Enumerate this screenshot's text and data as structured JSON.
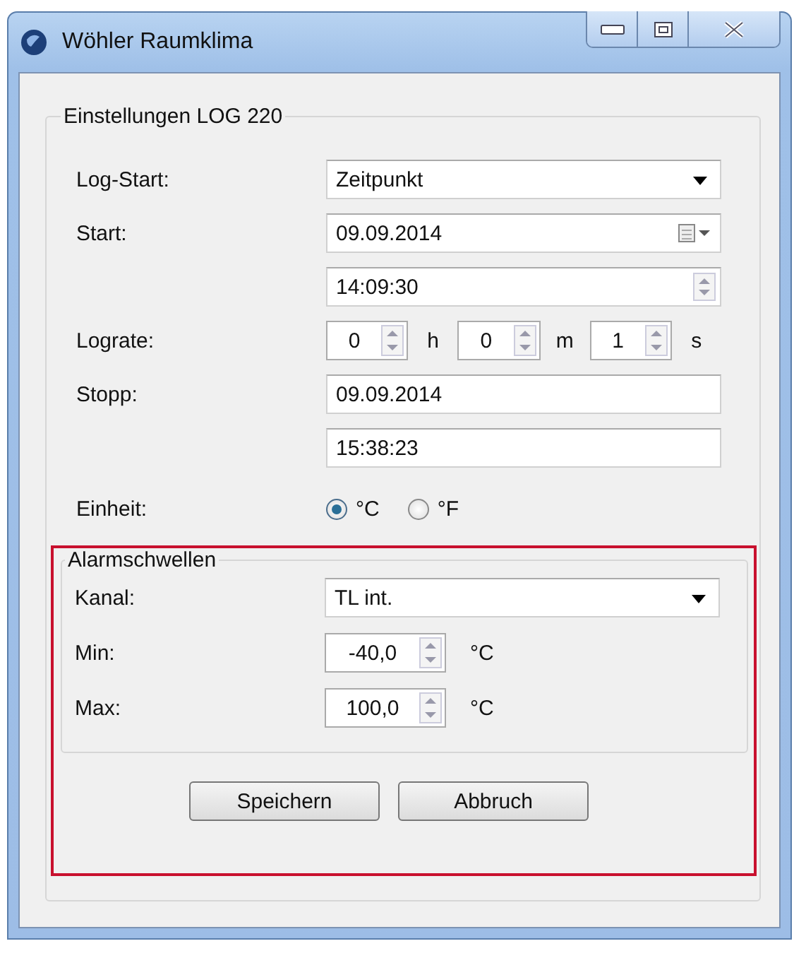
{
  "window": {
    "title": "Wöhler Raumklima"
  },
  "settings": {
    "title": "Einstellungen LOG 220",
    "log_start": {
      "label": "Log-Start:",
      "value": "Zeitpunkt"
    },
    "start": {
      "label": "Start:",
      "date": "09.09.2014",
      "time": "14:09:30"
    },
    "lograte": {
      "label": "Lograte:",
      "fields": [
        {
          "value": "0",
          "unit": "h"
        },
        {
          "value": "0",
          "unit": "m"
        },
        {
          "value": "1",
          "unit": "s"
        }
      ]
    },
    "stopp": {
      "label": "Stopp:",
      "date": "09.09.2014",
      "time": "15:38:23"
    },
    "unit": {
      "label": "Einheit:",
      "options": [
        {
          "label": "°C",
          "selected": true
        },
        {
          "label": "°F",
          "selected": false
        }
      ]
    }
  },
  "alarm": {
    "title": "Alarmschwellen",
    "channel": {
      "label": "Kanal:",
      "value": "TL int."
    },
    "thresholds": [
      {
        "label": "Min:",
        "value": "-40,0",
        "unit": "°C"
      },
      {
        "label": "Max:",
        "value": "100,0",
        "unit": "°C"
      }
    ]
  },
  "buttons": [
    "Speichern",
    "Abbruch"
  ]
}
